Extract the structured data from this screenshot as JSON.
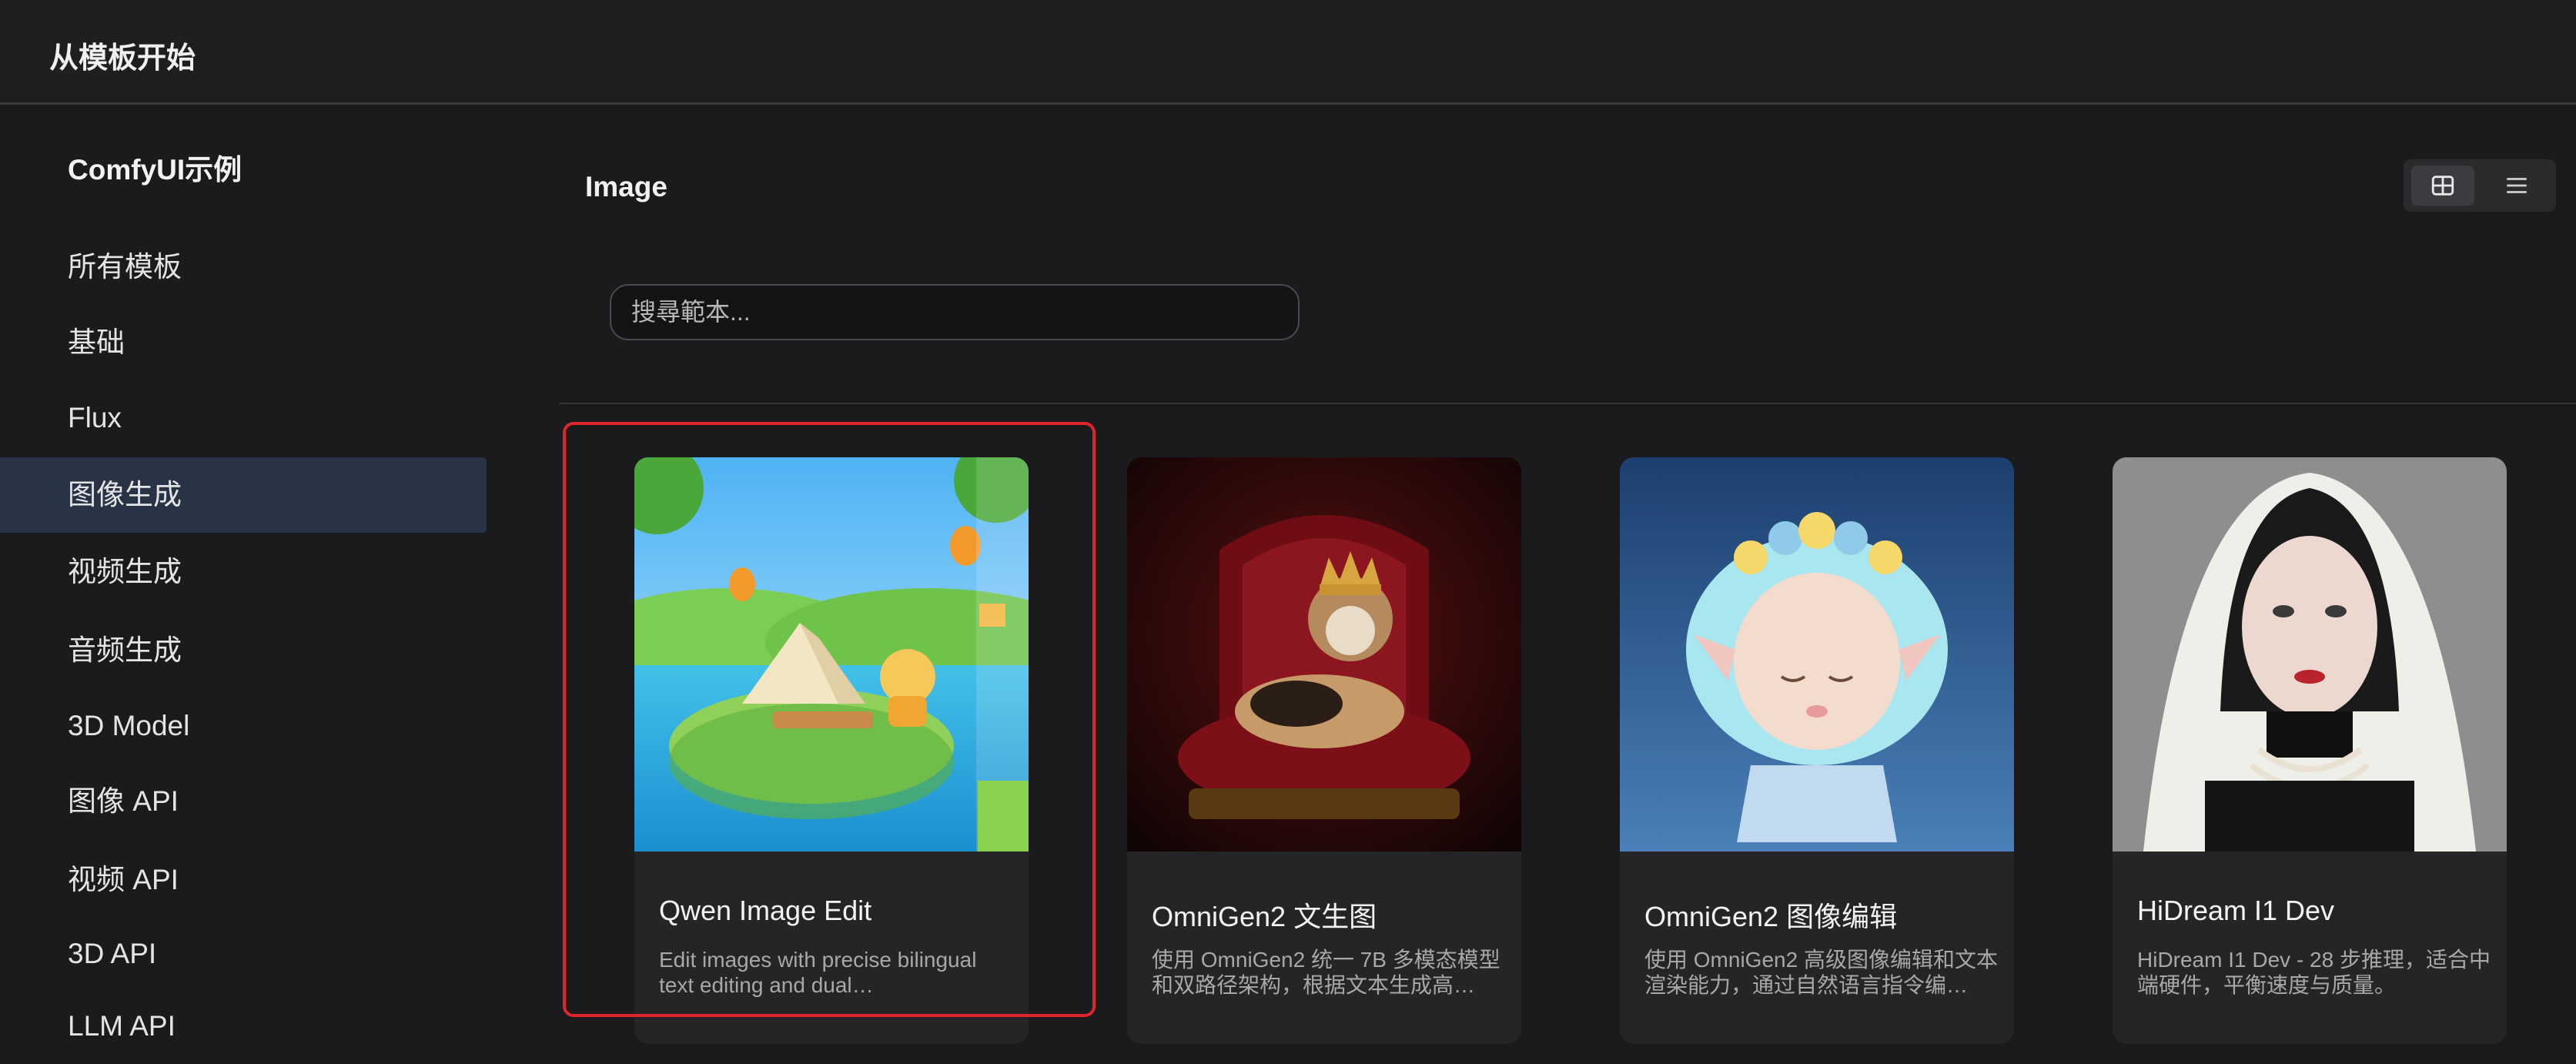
{
  "header": {
    "title": "从模板开始"
  },
  "sidebar": {
    "heading": "ComfyUI示例",
    "items": [
      {
        "label": "所有模板",
        "active": false
      },
      {
        "label": "基础",
        "active": false
      },
      {
        "label": "Flux",
        "active": false
      },
      {
        "label": "图像生成",
        "active": true
      },
      {
        "label": "视频生成",
        "active": false
      },
      {
        "label": "音频生成",
        "active": false
      },
      {
        "label": "3D Model",
        "active": false
      },
      {
        "label": "图像 API",
        "active": false
      },
      {
        "label": "视频 API",
        "active": false
      },
      {
        "label": "3D API",
        "active": false
      },
      {
        "label": "LLM API",
        "active": false
      }
    ]
  },
  "main": {
    "section_title": "Image",
    "search": {
      "placeholder": "搜尋範本...",
      "value": ""
    },
    "view_toggle": {
      "selected": "grid",
      "icons": [
        "grid-icon",
        "list-icon"
      ]
    },
    "cards": [
      {
        "title": "Qwen Image Edit",
        "description": "Edit images with precise bilingual text editing and dual…",
        "selected": true,
        "image": "campsite-island-illustration"
      },
      {
        "title": "OmniGen2 文生图",
        "description": "使用 OmniGen2 统一 7B 多模态模型和双路径架构，根据文本生成高…",
        "selected": false,
        "image": "cat-with-crown-on-throne"
      },
      {
        "title": "OmniGen2 图像编辑",
        "description": "使用 OmniGen2 高级图像编辑和文本渲染能力，通过自然语言指令编…",
        "selected": false,
        "image": "crystal-fairy-figurine"
      },
      {
        "title": "HiDream I1 Dev",
        "description": "HiDream I1 Dev - 28 步推理，适合中端硬件，平衡速度与质量。",
        "selected": false,
        "image": "portrait-woman-lace-veil"
      }
    ]
  },
  "colors": {
    "accent_active": "#283446",
    "selection_border": "#e0242b",
    "background": "#1b1b1d"
  }
}
